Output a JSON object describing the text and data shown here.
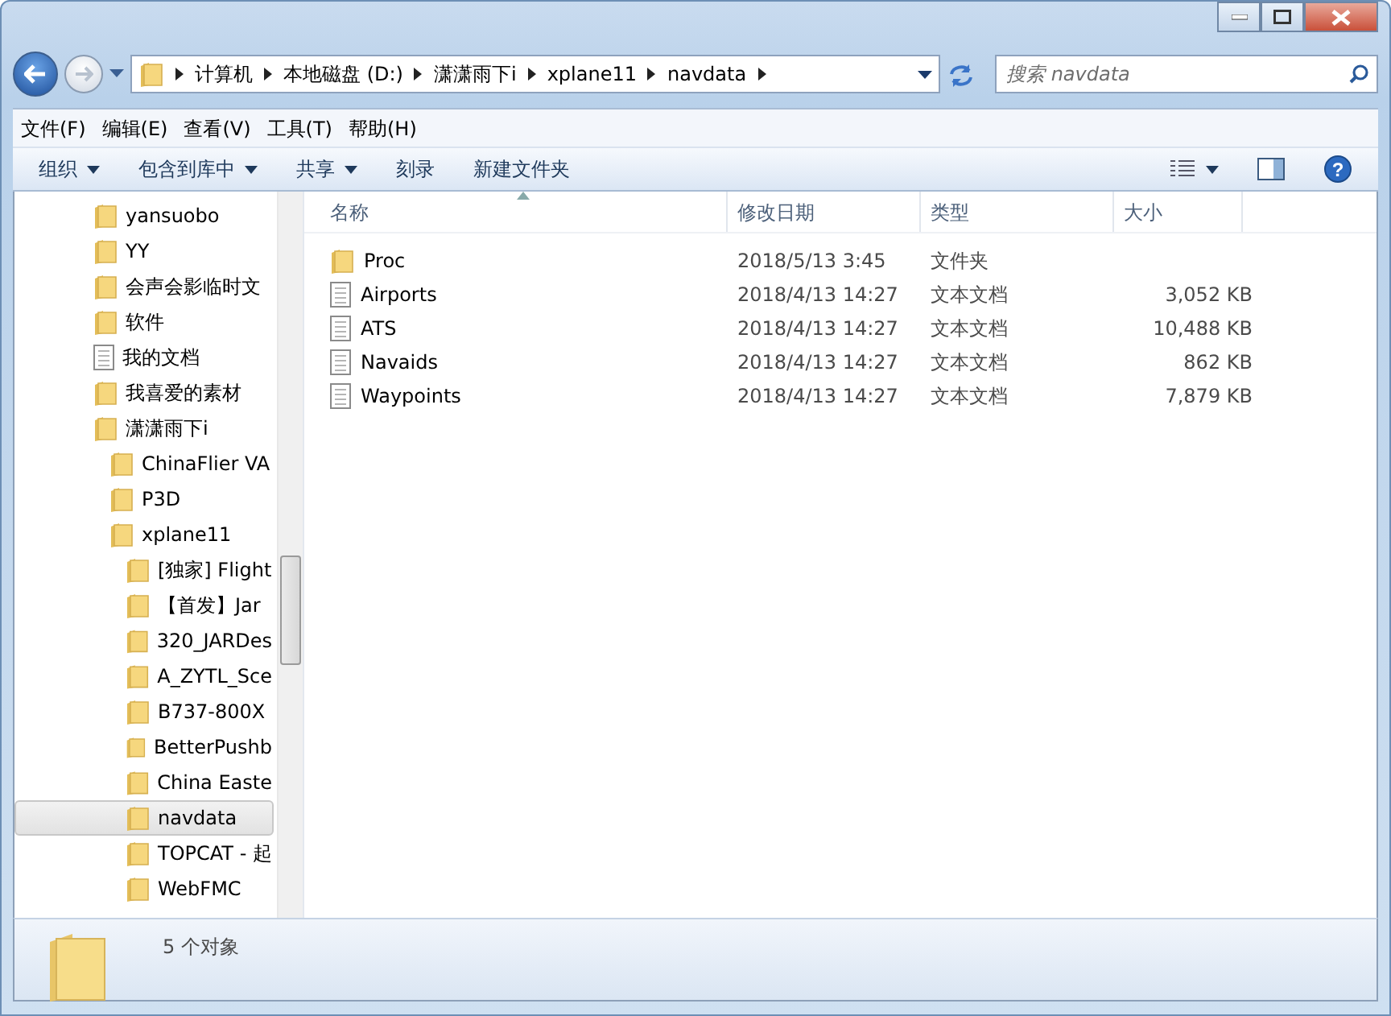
{
  "address_bar": {
    "segments": [
      "计算机",
      "本地磁盘 (D:)",
      "潇潇雨下i",
      "xplane11",
      "navdata"
    ]
  },
  "search": {
    "placeholder": "搜索 navdata"
  },
  "menu": [
    "文件(F)",
    "编辑(E)",
    "查看(V)",
    "工具(T)",
    "帮助(H)"
  ],
  "toolbar": [
    {
      "label": "组织",
      "dropdown": true
    },
    {
      "label": "包含到库中",
      "dropdown": true
    },
    {
      "label": "共享",
      "dropdown": true
    },
    {
      "label": "刻录",
      "dropdown": false
    },
    {
      "label": "新建文件夹",
      "dropdown": false
    }
  ],
  "sidebar": {
    "items": [
      {
        "label": "yansuobo",
        "kind": "folder",
        "selected": false
      },
      {
        "label": "YY",
        "kind": "folder",
        "selected": false
      },
      {
        "label": "会声会影临时文",
        "kind": "folder",
        "selected": false
      },
      {
        "label": "软件",
        "kind": "folder",
        "selected": false
      },
      {
        "label": "我的文档",
        "kind": "document",
        "selected": false
      },
      {
        "label": "我喜爱的素材",
        "kind": "folder",
        "selected": false
      },
      {
        "label": "潇潇雨下i",
        "kind": "folder",
        "selected": false,
        "children": [
          {
            "label": "ChinaFlier VA",
            "kind": "folder",
            "selected": false
          },
          {
            "label": "P3D",
            "kind": "folder",
            "selected": false
          },
          {
            "label": "xplane11",
            "kind": "folder",
            "selected": false,
            "children": [
              {
                "label": "[独家] Flight",
                "kind": "folder",
                "selected": false
              },
              {
                "label": "【首发】Jar",
                "kind": "folder",
                "selected": false
              },
              {
                "label": "320_JARDes",
                "kind": "folder",
                "selected": false
              },
              {
                "label": "A_ZYTL_Sce",
                "kind": "folder",
                "selected": false
              },
              {
                "label": "B737-800X",
                "kind": "folder",
                "selected": false
              },
              {
                "label": "BetterPushb",
                "kind": "folder",
                "selected": false
              },
              {
                "label": "China Easte",
                "kind": "folder",
                "selected": false
              },
              {
                "label": "navdata",
                "kind": "folder",
                "selected": true
              },
              {
                "label": "TOPCAT - 起",
                "kind": "folder",
                "selected": false
              },
              {
                "label": "WebFMC",
                "kind": "folder",
                "selected": false
              }
            ]
          }
        ]
      }
    ]
  },
  "table": {
    "columns": [
      "名称",
      "修改日期",
      "类型",
      "大小"
    ],
    "rows": [
      {
        "kind": "folder",
        "name": "Proc",
        "date": "2018/5/13 3:45",
        "type": "文件夹"
      },
      {
        "kind": "document",
        "name": "Airports",
        "date": "2018/4/13 14:27",
        "type": "文本文档",
        "size": "3,052 KB"
      },
      {
        "kind": "document",
        "name": "ATS",
        "date": "2018/4/13 14:27",
        "type": "文本文档",
        "size": "10,488 KB"
      },
      {
        "kind": "document",
        "name": "Navaids",
        "date": "2018/4/13 14:27",
        "type": "文本文档",
        "size": "862 KB"
      },
      {
        "kind": "document",
        "name": "Waypoints",
        "date": "2018/4/13 14:27",
        "type": "文本文档",
        "size": "7,879 KB"
      }
    ]
  },
  "help_button": {
    "label": "?"
  },
  "status_bar": {
    "text": "5 个对象"
  }
}
